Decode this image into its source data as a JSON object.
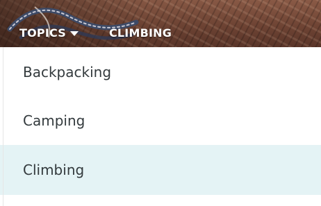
{
  "nav": {
    "topics_label": "TOPICS",
    "current_label": "CLIMBING"
  },
  "menu": {
    "items": [
      {
        "label": "Backpacking",
        "active": false
      },
      {
        "label": "Camping",
        "active": false
      },
      {
        "label": "Climbing",
        "active": true
      }
    ]
  },
  "colors": {
    "active_row_bg": "#e4f3f5",
    "menu_text": "#333a3d",
    "nav_text": "#ffffff"
  },
  "icons": {
    "topics_dropdown": "caret-down-icon"
  }
}
